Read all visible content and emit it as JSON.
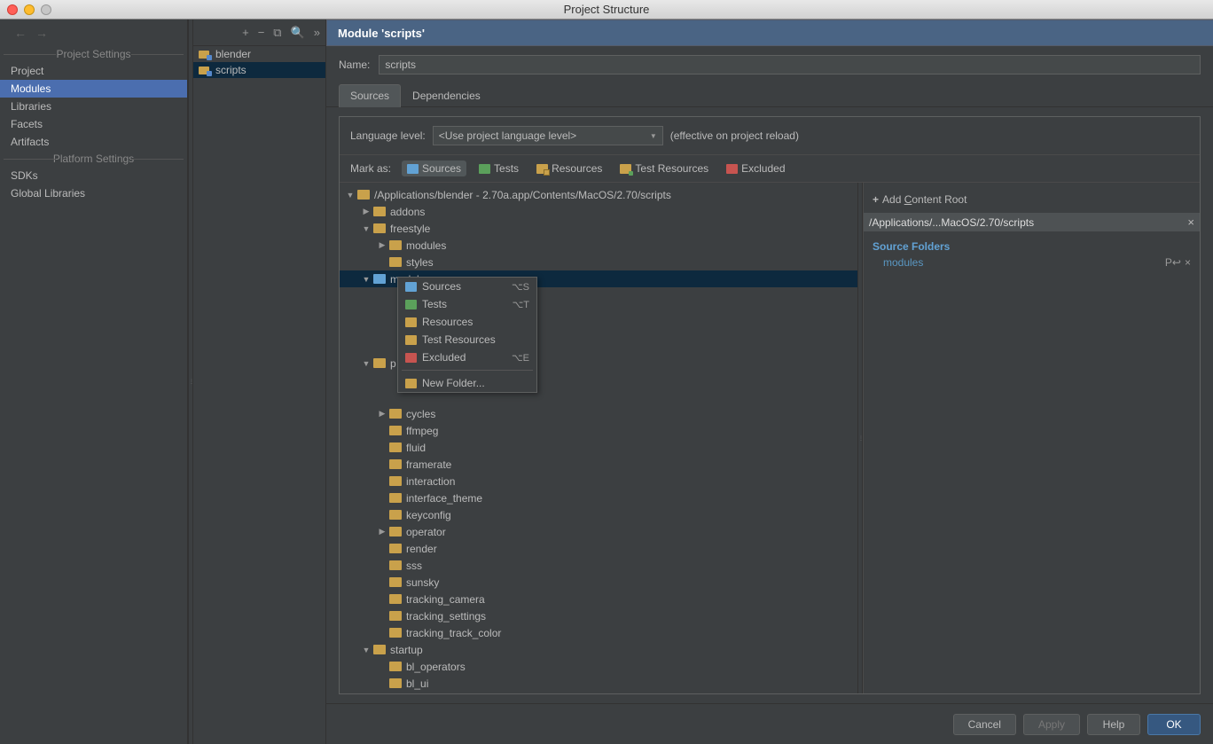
{
  "window": {
    "title": "Project Structure"
  },
  "leftPanel": {
    "projectSettingsLabel": "Project Settings",
    "platformSettingsLabel": "Platform Settings",
    "projectItems": [
      "Project",
      "Modules",
      "Libraries",
      "Facets",
      "Artifacts"
    ],
    "platformItems": [
      "SDKs",
      "Global Libraries"
    ],
    "selected": "Modules"
  },
  "midPanel": {
    "items": [
      "blender",
      "scripts"
    ],
    "selected": "scripts"
  },
  "moduleHeader": "Module 'scripts'",
  "nameLabel": "Name:",
  "nameValue": "scripts",
  "tabs": {
    "sources": "Sources",
    "dependencies": "Dependencies",
    "active": "Sources"
  },
  "langLevel": {
    "label": "Language level:",
    "value": "<Use project language level>",
    "note": "(effective on project reload)"
  },
  "markAs": {
    "label": "Mark as:",
    "sources": "Sources",
    "tests": "Tests",
    "resources": "Resources",
    "testResources": "Test Resources",
    "excluded": "Excluded"
  },
  "tree": {
    "root": "/Applications/blender - 2.70a.app/Contents/MacOS/2.70/scripts",
    "nodes": [
      {
        "label": "addons",
        "depth": 1,
        "arrow": "col",
        "icon": "normal"
      },
      {
        "label": "freestyle",
        "depth": 1,
        "arrow": "exp",
        "icon": "normal"
      },
      {
        "label": "modules",
        "depth": 2,
        "arrow": "col",
        "icon": "normal"
      },
      {
        "label": "styles",
        "depth": 2,
        "arrow": "none",
        "icon": "normal"
      },
      {
        "label": "modules",
        "depth": 1,
        "arrow": "exp",
        "icon": "src",
        "sel": true
      },
      {
        "label": "",
        "depth": 2,
        "arrow": "none",
        "icon": "",
        "spacer": true
      },
      {
        "label": "",
        "depth": 2,
        "arrow": "none",
        "icon": "",
        "spacer": true
      },
      {
        "label": "",
        "depth": 2,
        "arrow": "none",
        "icon": "",
        "spacer": true
      },
      {
        "label": "",
        "depth": 2,
        "arrow": "none",
        "icon": "",
        "spacer": true
      },
      {
        "label": "p",
        "depth": 1,
        "arrow": "exp",
        "icon": "normal"
      },
      {
        "label": "",
        "depth": 2,
        "arrow": "none",
        "icon": "",
        "spacer": true
      },
      {
        "label": "",
        "depth": 2,
        "arrow": "none",
        "icon": "",
        "spacer": true
      },
      {
        "label": "cycles",
        "depth": 2,
        "arrow": "col",
        "icon": "normal"
      },
      {
        "label": "ffmpeg",
        "depth": 2,
        "arrow": "none",
        "icon": "normal"
      },
      {
        "label": "fluid",
        "depth": 2,
        "arrow": "none",
        "icon": "normal"
      },
      {
        "label": "framerate",
        "depth": 2,
        "arrow": "none",
        "icon": "normal"
      },
      {
        "label": "interaction",
        "depth": 2,
        "arrow": "none",
        "icon": "normal"
      },
      {
        "label": "interface_theme",
        "depth": 2,
        "arrow": "none",
        "icon": "normal"
      },
      {
        "label": "keyconfig",
        "depth": 2,
        "arrow": "none",
        "icon": "normal"
      },
      {
        "label": "operator",
        "depth": 2,
        "arrow": "col",
        "icon": "normal"
      },
      {
        "label": "render",
        "depth": 2,
        "arrow": "none",
        "icon": "normal"
      },
      {
        "label": "sss",
        "depth": 2,
        "arrow": "none",
        "icon": "normal"
      },
      {
        "label": "sunsky",
        "depth": 2,
        "arrow": "none",
        "icon": "normal"
      },
      {
        "label": "tracking_camera",
        "depth": 2,
        "arrow": "none",
        "icon": "normal"
      },
      {
        "label": "tracking_settings",
        "depth": 2,
        "arrow": "none",
        "icon": "normal"
      },
      {
        "label": "tracking_track_color",
        "depth": 2,
        "arrow": "none",
        "icon": "normal"
      },
      {
        "label": "startup",
        "depth": 1,
        "arrow": "exp",
        "icon": "normal"
      },
      {
        "label": "bl_operators",
        "depth": 2,
        "arrow": "none",
        "icon": "normal"
      },
      {
        "label": "bl_ui",
        "depth": 2,
        "arrow": "none",
        "icon": "normal"
      }
    ]
  },
  "contextMenu": {
    "items": [
      {
        "label": "Sources",
        "shortcut": "⌥S",
        "icon": "sources"
      },
      {
        "label": "Tests",
        "shortcut": "⌥T",
        "icon": "tests"
      },
      {
        "label": "Resources",
        "shortcut": "",
        "icon": "resources"
      },
      {
        "label": "Test Resources",
        "shortcut": "",
        "icon": "testres"
      },
      {
        "label": "Excluded",
        "shortcut": "⌥E",
        "icon": "excluded"
      },
      {
        "sep": true
      },
      {
        "label": "New Folder...",
        "shortcut": "",
        "icon": "newfolder"
      }
    ]
  },
  "infoPanel": {
    "addRoot": "Add Content Root",
    "rootPath": "/Applications/...MacOS/2.70/scripts",
    "sourceFoldersLabel": "Source Folders",
    "sourceFolders": [
      "modules"
    ]
  },
  "footer": {
    "cancel": "Cancel",
    "apply": "Apply",
    "help": "Help",
    "ok": "OK"
  }
}
